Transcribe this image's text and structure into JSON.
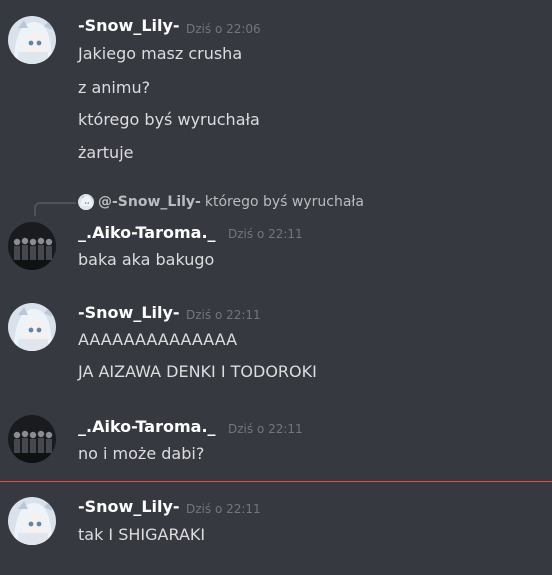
{
  "messages": [
    {
      "username": "-Snow_Lily-",
      "timestamp": "Dziś o 22:06",
      "avatar": "snow-lily-avatar",
      "lines": [
        "Jakiego masz crusha",
        "z animu?",
        "którego byś wyruchała",
        "żartuje"
      ]
    },
    {
      "reply": {
        "author": "@-Snow_Lily-",
        "text": "którego byś wyruchała"
      },
      "username": "_.Aiko-Taroma._",
      "timestamp": "Dziś o 22:11",
      "avatar": "aiko-taroma-avatar",
      "lines": [
        "baka aka bakugo"
      ]
    },
    {
      "username": "-Snow_Lily-",
      "timestamp": "Dziś o 22:11",
      "avatar": "snow-lily-avatar",
      "lines": [
        "AAAAAAAAAAAAAA",
        "JA AIZAWA DENKI I TODOROKI"
      ]
    },
    {
      "username": "_.Aiko-Taroma._",
      "timestamp": "Dziś o 22:11",
      "avatar": "aiko-taroma-avatar",
      "lines": [
        "no i może dabi?"
      ]
    },
    {
      "username": "-Snow_Lily-",
      "timestamp": "Dziś o 22:11",
      "avatar": "snow-lily-avatar",
      "lines": [
        "tak I SHIGARAKI"
      ]
    }
  ],
  "colors": {
    "background": "#36393f",
    "username": "#ffffff",
    "text": "#dcddde",
    "timestamp": "#72767d",
    "new_messages_divider": "#f04747"
  }
}
